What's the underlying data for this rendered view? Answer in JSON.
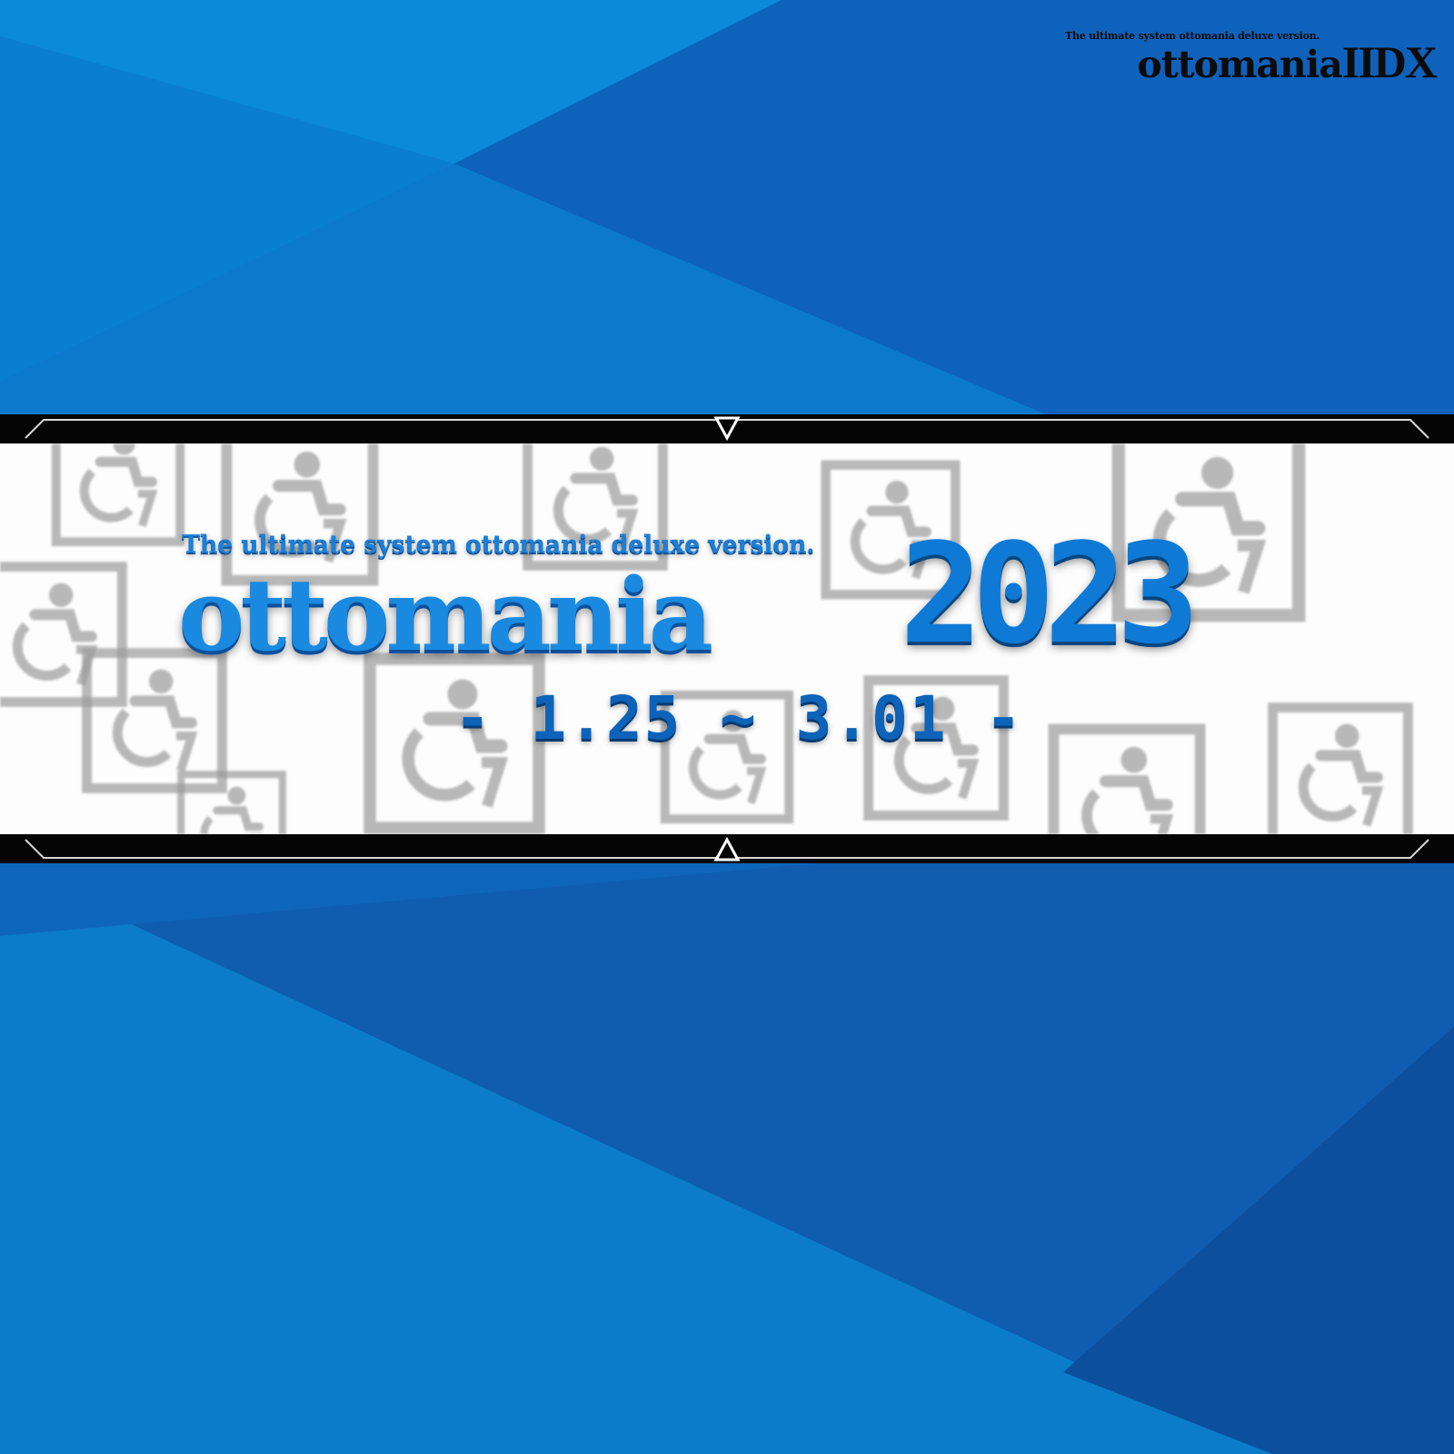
{
  "colors": {
    "background": "#0a6fc4",
    "accent_light": "#1a8ae0",
    "accent_dark": "#0a4f9c",
    "frame": "#050505",
    "strip": "#fdfdfd"
  },
  "corner_logo": {
    "tagline": "The ultimate system ottomania deluxe version.",
    "name": "ottomania",
    "suffix": "IIDX"
  },
  "banner": {
    "tagline": "The ultimate system ottomania deluxe version.",
    "wordmark": "ottomania",
    "year": "2023",
    "dates": "- 1.25 ~ 3.01 -"
  },
  "icons": {
    "background_pattern": "wheelchair-sign-icon",
    "frame_marker_top": "triangle-down-icon",
    "frame_marker_bottom": "triangle-up-icon"
  }
}
